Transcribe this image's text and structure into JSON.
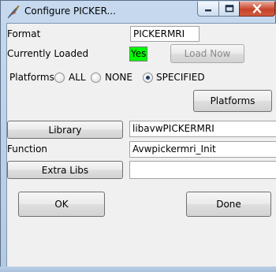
{
  "window": {
    "title": "Configure PICKER...",
    "controls": {
      "minimize": "minimize",
      "maximize": "maximize",
      "close": "close"
    }
  },
  "format": {
    "label": "Format",
    "value": "PICKERMRI"
  },
  "loaded": {
    "label": "Currently Loaded",
    "status": "Yes",
    "status_color": "#00ff00",
    "load_now_label": "Load Now"
  },
  "platforms": {
    "label": "Platforms",
    "options": [
      {
        "label": "ALL",
        "checked": false
      },
      {
        "label": "NONE",
        "checked": false
      },
      {
        "label": "SPECIFIED",
        "checked": true
      }
    ],
    "button_label": "Platforms"
  },
  "library": {
    "button_label": "Library",
    "value": "libavwPICKERMRI"
  },
  "function": {
    "label": "Function",
    "value": "Avwpickermri_Init"
  },
  "extra_libs": {
    "button_label": "Extra Libs",
    "value": ""
  },
  "actions": {
    "ok_label": "OK",
    "done_label": "Done"
  }
}
